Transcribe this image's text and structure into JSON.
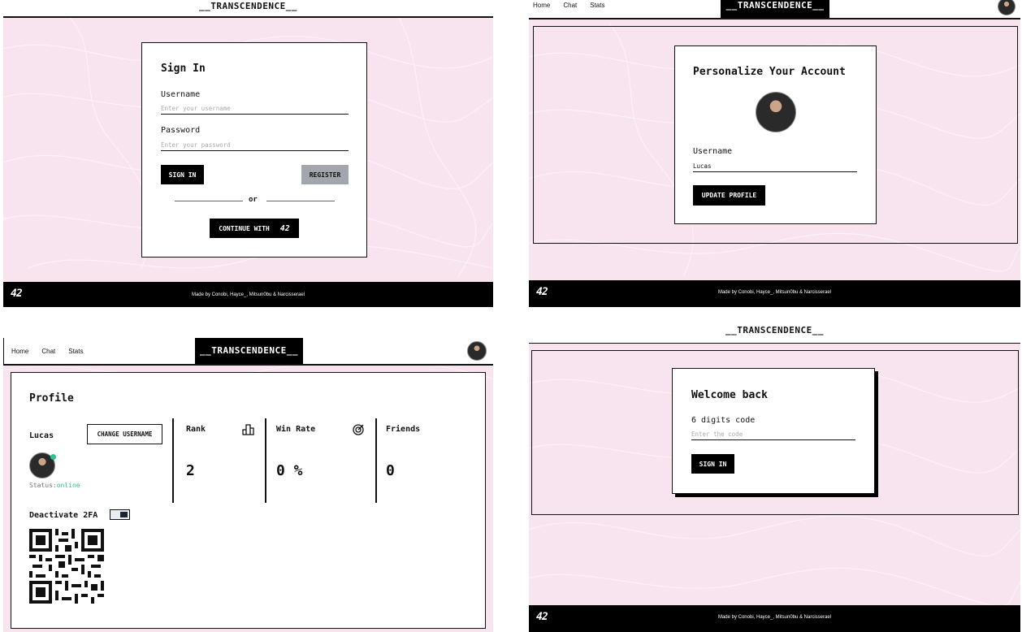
{
  "brand": "__TRANSCENDENCE__",
  "nav": [
    "Home",
    "Chat",
    "Stats"
  ],
  "footer": {
    "logo": "42",
    "credits": "Made by Conobi, Hayce_, Mitsun0bu & Narcisserael"
  },
  "signin": {
    "title": "Sign In",
    "username_label": "Username",
    "username_placeholder": "Enter your username",
    "password_label": "Password",
    "password_placeholder": "Enter your password",
    "signin_button": "SIGN IN",
    "register_button": "REGISTER",
    "or_text": "or",
    "continue_button": "CONTINUE WITH",
    "continue_logo": "42"
  },
  "personalize": {
    "title": "Personalize Your Account",
    "username_label": "Username",
    "username_value": "Lucas",
    "update_button": "UPDATE PROFILE"
  },
  "profile": {
    "title": "Profile",
    "user_name": "Lucas",
    "change_username_button": "CHANGE USERNAME",
    "status_label": "Status:",
    "status_value": "online",
    "rank_label": "Rank",
    "rank_value": "2",
    "winrate_label": "Win Rate",
    "winrate_value": "0 %",
    "friends_label": "Friends",
    "friends_value": "0",
    "twofa_label": "Deactivate 2FA"
  },
  "welcome": {
    "title": "Welcome back",
    "code_label": "6 digits code",
    "code_placeholder": "Enter the code",
    "signin_button": "SIGN IN"
  },
  "colors": {
    "page_bg": "#f8e4ee",
    "accent": "#000000",
    "status_online": "#2bc58a",
    "register_gray": "#a4a6ae"
  }
}
